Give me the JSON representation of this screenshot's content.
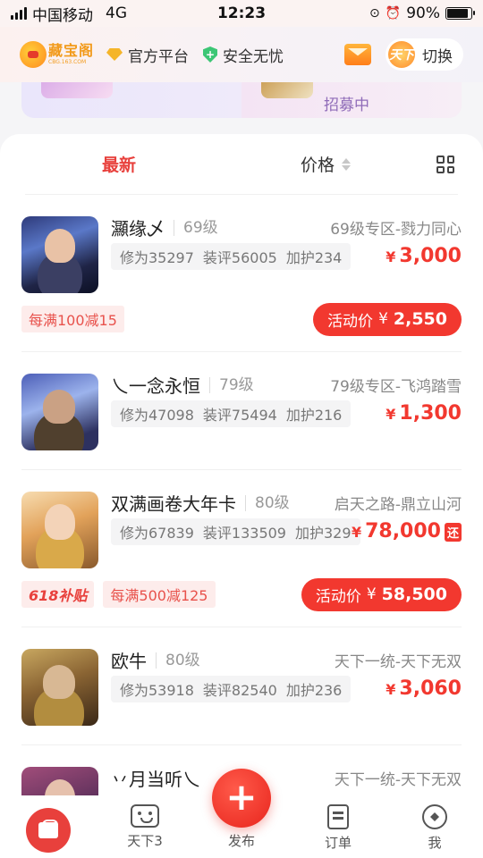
{
  "status_bar": {
    "carrier": "中国移动",
    "network": "4G",
    "time": "12:23",
    "battery": "90%",
    "battery_level": 0.9
  },
  "header": {
    "logo_text": "藏宝阁",
    "logo_sub": "CBG.163.COM",
    "badge_official": "官方平台",
    "badge_safe": "安全无忧",
    "switch_label": "切换",
    "switch_avatar_text": "天下"
  },
  "banner": {
    "right_text": "招募中"
  },
  "sort_bar": {
    "latest": "最新",
    "price": "价格"
  },
  "items": [
    {
      "name": "灦缘乄",
      "level": "69级",
      "server": "69级专区-戮力同心",
      "tags": [
        "修为35297",
        "装评56005",
        "加护234"
      ],
      "price": "3,000",
      "coupon": "每满100减15",
      "activity_label": "活动价",
      "activity_price": "2,550"
    },
    {
      "name": "乀一念永恒",
      "level": "79级",
      "server": "79级专区-飞鸿踏雪",
      "tags": [
        "修为47098",
        "装评75494",
        "加护216"
      ],
      "price": "1,300"
    },
    {
      "name": "双满画卷大年卡",
      "level": "80级",
      "server": "启天之路-鼎立山河",
      "tags": [
        "修为67839",
        "装评133509",
        "加护329"
      ],
      "price": "78,000",
      "return_badge": "还",
      "subsidy": "618补贴",
      "coupon": "每满500减125",
      "activity_label": "活动价",
      "activity_price": "58,500"
    },
    {
      "name": "欧牛",
      "level": "80级",
      "server": "天下一统-天下无双",
      "tags": [
        "修为53918",
        "装评82540",
        "加护236"
      ],
      "price": "3,060"
    },
    {
      "name": "丷月当听乀",
      "server": "天下一统-天下无双"
    }
  ],
  "currency": "¥",
  "bottom_nav": {
    "game": "天下3",
    "publish": "发布",
    "orders": "订单",
    "me": "我",
    "publish_symbol": "+"
  },
  "colors": {
    "accent": "#f2382f",
    "brand_orange": "#f29a1a"
  }
}
